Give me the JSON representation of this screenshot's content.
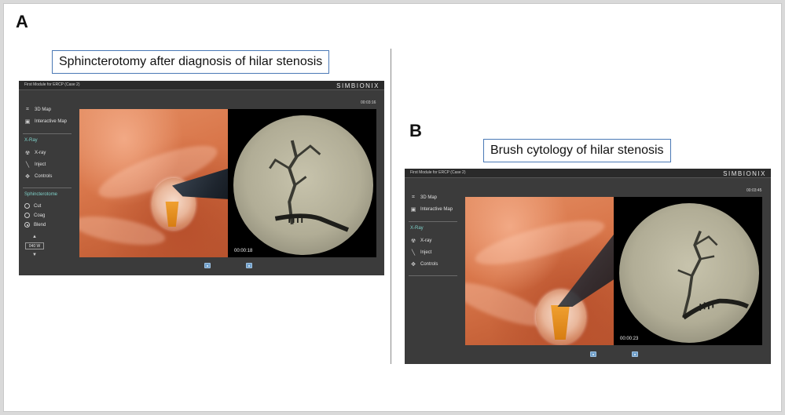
{
  "panels": [
    {
      "letter": "A",
      "caption": "Sphincterotomy after diagnosis of hilar stenosis",
      "sim": {
        "module_title": "First Module for ERCP (Case 2)",
        "brand": "SIMBIONIX",
        "timer": "00:03:16",
        "video_time": "00:00:18",
        "menu": {
          "map_3d": "3D Map",
          "interactive_map": "Interactive Map",
          "xray_section": "X-Ray",
          "xray": "X-ray",
          "inject": "Inject",
          "controls": "Controls",
          "sphincterotome_section": "Sphincterotome",
          "cut": "Cut",
          "coag": "Coag",
          "blend": "Blend",
          "power": "040 W"
        },
        "selected_mode": "Blend"
      }
    },
    {
      "letter": "B",
      "caption": "Brush cytology of hilar stenosis",
      "sim": {
        "module_title": "First Module for ERCP (Case 2)",
        "brand": "SIMBIONIX",
        "timer": "00:03:45",
        "video_time": "00:00:23",
        "menu": {
          "map_3d": "3D Map",
          "interactive_map": "Interactive Map",
          "xray_section": "X-Ray",
          "xray": "X-ray",
          "inject": "Inject",
          "controls": "Controls"
        }
      }
    }
  ],
  "icons": {
    "map_3d": "map-3d-icon",
    "interactive_map": "interactive-map-icon",
    "xray": "radiation-icon",
    "inject": "syringe-icon",
    "controls": "move-arrows-icon",
    "camera": "camera-icon"
  },
  "colors": {
    "sim_background": "#3b3b3b",
    "section_label": "#7ed0c8",
    "caption_border": "#4a78b5",
    "camera_button": "#6f9ec8"
  }
}
